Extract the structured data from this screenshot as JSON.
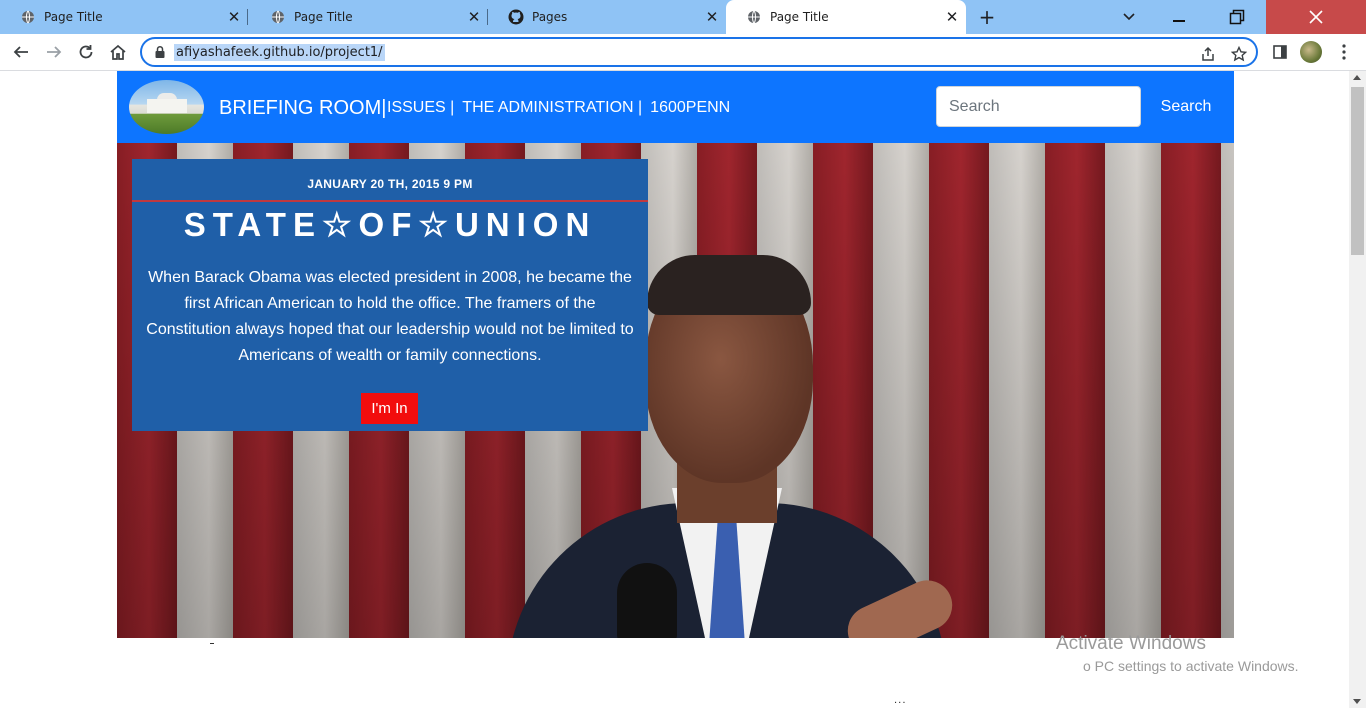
{
  "browser": {
    "tabs": [
      {
        "title": "Page Title",
        "favicon": "globe-icon",
        "active": false
      },
      {
        "title": "Page Title",
        "favicon": "globe-icon",
        "active": false
      },
      {
        "title": "Pages",
        "favicon": "github-icon",
        "active": false
      },
      {
        "title": "Page Title",
        "favicon": "globe-icon",
        "active": true
      }
    ],
    "new_tab_symbol": "+",
    "close_symbol": "✕",
    "address": "afiyashafeek.github.io/project1/",
    "colors": {
      "tabstrip": "#8fc3f5",
      "close_window": "#c74a4a",
      "omnibox_border": "#1a73e8"
    }
  },
  "site": {
    "brand": "BRIEFING ROOM|",
    "nav_links": [
      "ISSUES |",
      "THE ADMINISTRATION |",
      "1600PENN"
    ],
    "search_placeholder": "Search",
    "search_button": "Search",
    "colors": {
      "navbar": "#0d75ff",
      "card": "#1f5fa8",
      "cta": "#f20d0d",
      "rule": "#c0393f"
    }
  },
  "card": {
    "date": "JANUARY 20 TH, 2015 9 PM",
    "headline": "STATE☆OF☆UNION",
    "body": "When Barack Obama was elected president in 2008, he became the first African American to hold the office. The framers of the Constitution always hoped that our leadership would not be limited to Americans of wealth or family connections.",
    "cta_label": "I'm In"
  },
  "overlay": {
    "activate_line1": "Activate Windows",
    "activate_line2": "o PC settings to activate Windows.",
    "ellipsis": "..."
  }
}
